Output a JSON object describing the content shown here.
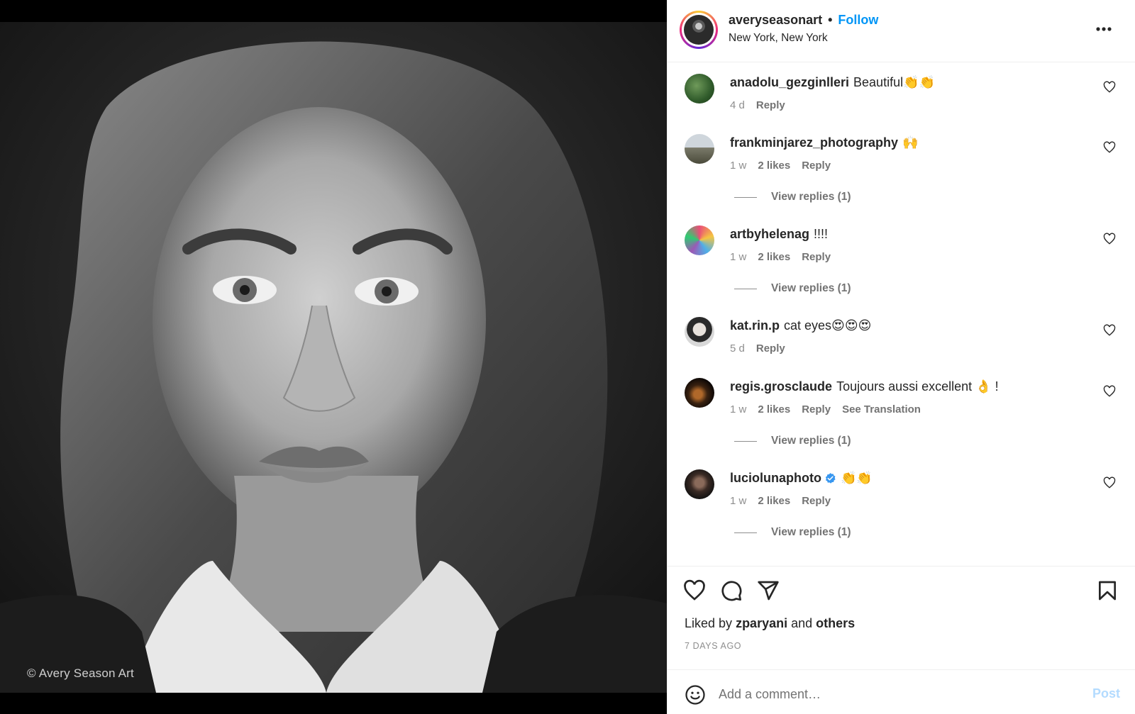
{
  "media": {
    "watermark": "© Avery Season Art"
  },
  "post": {
    "author": "averyseasonart",
    "separator": "•",
    "follow_label": "Follow",
    "location": "New York, New York"
  },
  "comments": [
    {
      "user": "anadolu_gezginlleri",
      "text": "Beautiful👏👏",
      "time": "4 d",
      "likes": "",
      "reply": "Reply",
      "verified": false
    },
    {
      "user": "frankminjarez_photography",
      "text": "🙌",
      "time": "1 w",
      "likes": "2 likes",
      "reply": "Reply",
      "replies": "View replies (1)"
    },
    {
      "user": "artbyhelenag",
      "text": "!!!!",
      "time": "1 w",
      "likes": "2 likes",
      "reply": "Reply",
      "replies": "View replies (1)"
    },
    {
      "user": "kat.rin.p",
      "text": "cat eyes😍😍😍",
      "time": "5 d",
      "likes": "",
      "reply": "Reply"
    },
    {
      "user": "regis.grosclaude",
      "text": "Toujours aussi excellent 👌 !",
      "time": "1 w",
      "likes": "2 likes",
      "reply": "Reply",
      "translate": "See Translation",
      "replies": "View replies (1)"
    },
    {
      "user": "luciolunaphoto",
      "text": "👏👏",
      "time": "1 w",
      "likes": "2 likes",
      "reply": "Reply",
      "verified": true,
      "replies": "View replies (1)"
    }
  ],
  "likes": {
    "prefix": "Liked by",
    "user": "zparyani",
    "middle": "and",
    "others": "others"
  },
  "post_age": "7 DAYS AGO",
  "add_comment": {
    "placeholder": "Add a comment…",
    "post_label": "Post"
  },
  "icons": {
    "more": "more-horizontal-icon",
    "like": "heart-icon",
    "comment": "comment-bubble-icon",
    "share": "paper-plane-icon",
    "save": "bookmark-icon",
    "emoji": "emoji-smile-icon",
    "verified": "verified-badge-icon"
  },
  "colors": {
    "accent": "#0095f6",
    "post_disabled": "#b3dbff",
    "verified": "#3897f0",
    "muted": "#8e8e8e"
  }
}
